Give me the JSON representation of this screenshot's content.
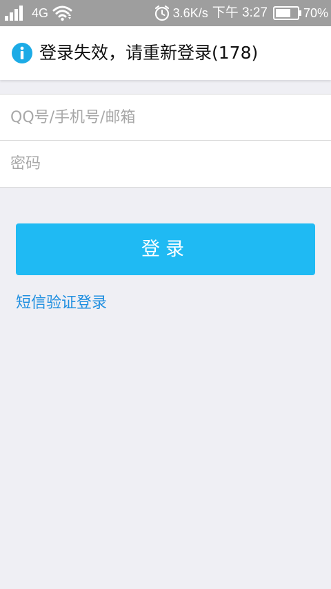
{
  "status_bar": {
    "network": "4G",
    "speed": "3.6K/s",
    "time": "下午 3:27",
    "battery": "70%",
    "battery_level": 0.7,
    "icons": [
      "signal-icon",
      "wifi-icon",
      "alarm-icon",
      "battery-icon"
    ]
  },
  "notice": {
    "icon": "info-icon",
    "text": "登录失效，请重新登录(178)"
  },
  "form": {
    "account_placeholder": "QQ号/手机号/邮箱",
    "account_value": "",
    "password_placeholder": "密码",
    "password_value": ""
  },
  "actions": {
    "login_label": "登录",
    "sms_login_label": "短信验证登录"
  },
  "colors": {
    "status_bar": "#9e9e9e",
    "accent": "#1fbaf3",
    "link": "#1f8fe0",
    "info_icon": "#1cabe6",
    "background": "#efeff4"
  }
}
